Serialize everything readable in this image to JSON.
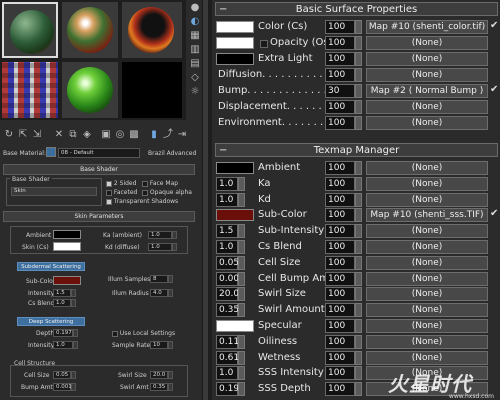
{
  "left": {
    "material_label": "Base Material:",
    "material_dropdown": "08 - Default",
    "material_type": "Brazil Advanced",
    "base_shader_header": "Base Shader",
    "base_shader_group": "Base Shader",
    "shader_value": "Skin",
    "opt_2sided": "2 Sided",
    "opt_facemap": "Face Map",
    "opt_faceted": "Faceted",
    "opt_opaque": "Opaque alpha",
    "opt_transparent": "Transparent Shadows",
    "skin_params_header": "Skin Parameters",
    "ambient_label": "Ambient",
    "skin_cs_label": "Skin (Cs)",
    "ka_label": "Ka (ambient)",
    "ka_value": "1.0",
    "kd_label": "Kd (diffuse)",
    "kd_value": "1.0",
    "sss_tab": "Subdermal Scattering",
    "subcolor_label": "Sub-Color",
    "intensity_label": "Intensity",
    "intensity_value": "1.5",
    "csblend_label": "Cs Blend",
    "csblend_value": "1.0",
    "illum_samples_label": "Illum Samples",
    "illum_samples_value": "8",
    "illum_radius_label": "Illum Radius",
    "illum_radius_value": "4.0",
    "deep_tab": "Deep Scattering",
    "depth_label": "Depth",
    "depth_value": "0.197",
    "deep_intensity_label": "Intensity",
    "deep_intensity_value": "1.0",
    "use_local": "Use Local Settings",
    "sample_rate_label": "Sample Rate",
    "sample_rate_value": "10",
    "cell_structure": "Cell Structure",
    "cell_size_label": "Cell Size",
    "cell_size_value": "0.05",
    "swirl_size_label": "Swirl Size",
    "swirl_size_value": "20.0",
    "bump_amt_label": "Bump Amt",
    "bump_amt_value": "0.001",
    "swirl_amt_label": "Swirl Amt",
    "swirl_amt_value": "0.35"
  },
  "basic": {
    "header": "Basic Surface Properties",
    "rows": [
      {
        "label": "Color (Cs)",
        "value": "100",
        "map": "Map #10 (shenti_color.tif)",
        "check": "✔"
      },
      {
        "label": "Opacity (Os)",
        "value": "100",
        "map": "(None)",
        "check": ""
      },
      {
        "label": "Extra Light",
        "value": "100",
        "map": "(None)",
        "check": ""
      },
      {
        "label": "Diffusion. . . . . . . . . . . . .",
        "value": "100",
        "map": "(None)",
        "check": ""
      },
      {
        "label": "Bump. . . . . . . . . . . . . . .",
        "value": "30",
        "map": "Map #2  ( Normal Bump )",
        "check": "✔"
      },
      {
        "label": "Displacement. . . . . . . . .",
        "value": "100",
        "map": "(None)",
        "check": ""
      },
      {
        "label": "Environment. . . . . . . . . .",
        "value": "100",
        "map": "(None)",
        "check": ""
      }
    ]
  },
  "texmap": {
    "header": "Texmap Manager",
    "rows": [
      {
        "num": "",
        "label": "Ambient",
        "value": "100",
        "map": "(None)",
        "check": ""
      },
      {
        "num": "1.0",
        "label": "Ka",
        "value": "100",
        "map": "(None)",
        "check": ""
      },
      {
        "num": "1.0",
        "label": "Kd",
        "value": "100",
        "map": "(None)",
        "check": ""
      },
      {
        "num": "",
        "label": "Sub-Color",
        "value": "100",
        "map": "Map #10  (shenti_sss.TIF)",
        "check": "✔"
      },
      {
        "num": "1.5",
        "label": "Sub-Intensity",
        "value": "100",
        "map": "(None)",
        "check": ""
      },
      {
        "num": "1.0",
        "label": "Cs Blend",
        "value": "100",
        "map": "(None)",
        "check": ""
      },
      {
        "num": "0.05",
        "label": "Cell Size",
        "value": "100",
        "map": "(None)",
        "check": ""
      },
      {
        "num": "0.001",
        "label": "Cell Bump Amt",
        "value": "100",
        "map": "(None)",
        "check": ""
      },
      {
        "num": "20.0",
        "label": "Swirl Size",
        "value": "100",
        "map": "(None)",
        "check": ""
      },
      {
        "num": "0.35",
        "label": "Swirl Amount",
        "value": "100",
        "map": "(None)",
        "check": ""
      },
      {
        "num": "",
        "label": "Specular",
        "value": "100",
        "map": "(None)",
        "check": ""
      },
      {
        "num": "0.11",
        "label": "Oiliness",
        "value": "100",
        "map": "(None)",
        "check": ""
      },
      {
        "num": "0.61",
        "label": "Wetness",
        "value": "100",
        "map": "(None)",
        "check": ""
      },
      {
        "num": "1.0",
        "label": "SSS Intensity",
        "value": "100",
        "map": "(None)",
        "check": ""
      },
      {
        "num": "0.197",
        "label": "SSS Depth",
        "value": "100",
        "map": "(None)",
        "check": ""
      }
    ]
  },
  "watermark": {
    "text": "火星时代",
    "url": "www.hxsd.com"
  },
  "colors": {
    "panel_bg": "#2b2b2b",
    "subcolor": "#6b0f0a",
    "blue_tab": "#3e6f9e"
  }
}
